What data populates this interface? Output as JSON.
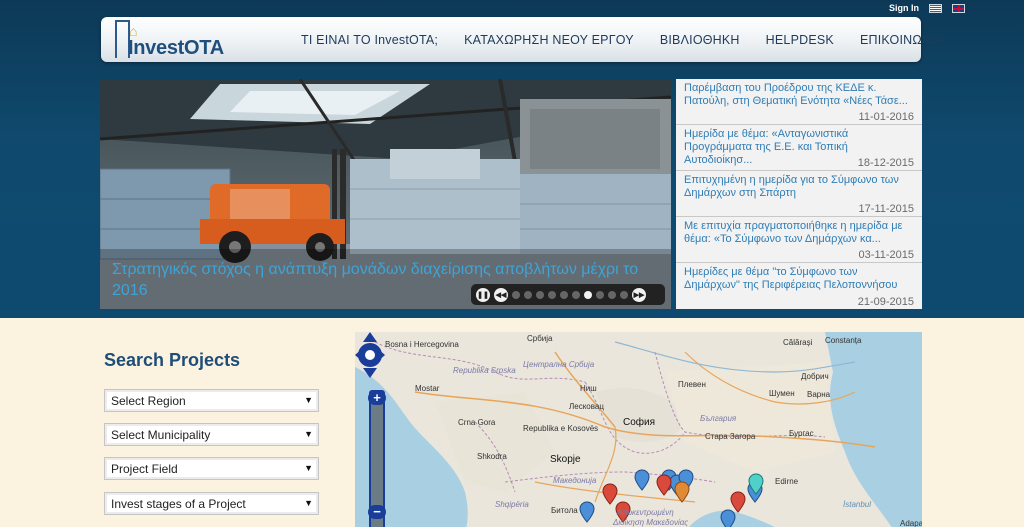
{
  "header": {
    "signin": "Sign In",
    "logo_text_a": "Invest",
    "logo_text_b": "OTA",
    "nav": [
      {
        "label": "ΤΙ ΕΙΝΑΙ ΤΟ InvestOTA;"
      },
      {
        "label": "ΚΑΤΑΧΩΡΗΣΗ ΝΕΟΥ ΕΡΓΟΥ"
      },
      {
        "label": "ΒΙΒΛΙΟΘΗΚΗ"
      },
      {
        "label": "HELPDESK"
      },
      {
        "label": "ΕΠΙΚΟΙΝΩΝΙΑ"
      }
    ]
  },
  "slider": {
    "caption": "Στρατηγικός στόχος η ανάπτυξη μονάδων διαχείρισης αποβλήτων μέχρι το 2016",
    "dot_count": 10,
    "active_dot": 7
  },
  "news": [
    {
      "text": "Παρέμβαση του Προέδρου της ΚΕΔΕ κ. Πατούλη, στη Θεματική Ενότητα «Νέες Τάσε...",
      "date": "11-01-2016"
    },
    {
      "text": "Ημερίδα με θέμα: «Ανταγωνιστικά Προγράμματα της Ε.Ε. και Τοπική Αυτοδιοίκησ...",
      "date": "18-12-2015"
    },
    {
      "text": "Επιτυχημένη η ημερίδα για το Σύμφωνο των Δημάρχων στη Σπάρτη",
      "date": "17-11-2015"
    },
    {
      "text": "Με επιτυχία πραγματοποιήθηκε η ημερίδα με θέμα: «Το Σύμφωνο των Δημάρχων κα...",
      "date": "03-11-2015"
    },
    {
      "text": "Ημερίδες με θέμα \"το Σύμφωνο των Δημάρχων\" της Περιφέρειας Πελοποννήσου",
      "date": "21-09-2015"
    }
  ],
  "search": {
    "title": "Search Projects",
    "region": "Select Region",
    "municipality": "Select Municipality",
    "field": "Project Field",
    "stages": "Invest stages of a Project"
  },
  "map": {
    "labels": {
      "bosnia": "Bosna i Hercegovina",
      "srbija": "Србија",
      "srpska": "Republika Srpska",
      "central_serbia": "Централна Србија",
      "mostar": "Mostar",
      "nish": "Ниш",
      "leskovac": "Лесковац",
      "pleven": "Плевен",
      "dobrich": "Добрич",
      "varna": "Варна",
      "shumen": "Шумен",
      "calarasi": "Călărași",
      "constanta": "Constanța",
      "crna_gora": "Crna Gora",
      "kosovo": "Republika e Kosovës",
      "sofia": "София",
      "bulgaria": "България",
      "stara_zagora": "Стара Загора",
      "burgas": "Бургас",
      "shkodra": "Shkodra",
      "skopje": "Skopje",
      "makedonija": "Македонија",
      "shqiperia": "Shqipëria",
      "bitola": "Битола",
      "apokentromeni": "Αποκεντρωμένη",
      "dioikisi": "Διοίκηση Μακεδονίας",
      "edirne": "Edirne",
      "istanbul": "İstanbul",
      "adapa": "Adapa"
    }
  }
}
